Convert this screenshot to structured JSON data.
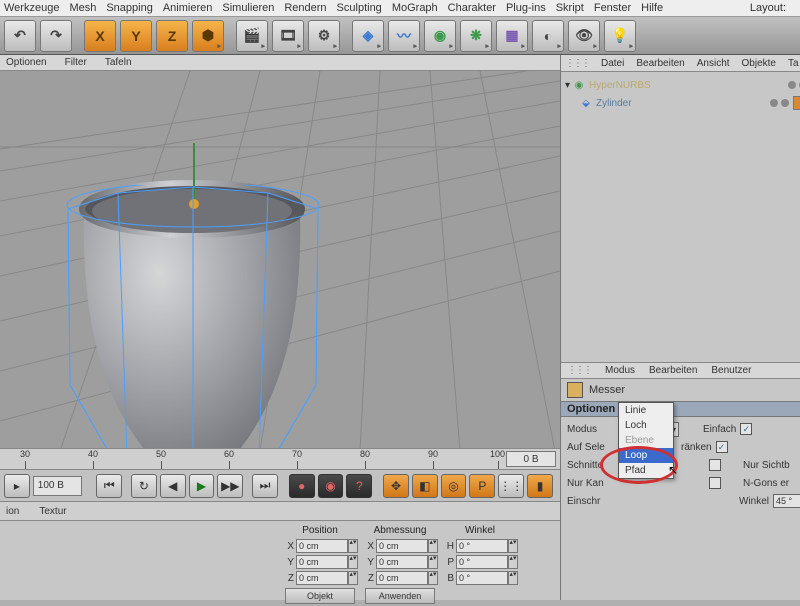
{
  "menu": [
    "Werkzeuge",
    "Mesh",
    "Snapping",
    "Animieren",
    "Simulieren",
    "Rendern",
    "Sculpting",
    "MoGraph",
    "Charakter",
    "Plug-ins",
    "Skript",
    "Fenster",
    "Hilfe"
  ],
  "layout_label": "Layout:",
  "toolbar": {
    "axes": [
      "X",
      "Y",
      "Z"
    ]
  },
  "viewbar": [
    "Optionen",
    "Filter",
    "Tafeln"
  ],
  "object_panel_menu": [
    "Datei",
    "Bearbeiten",
    "Ansicht",
    "Objekte",
    "Ta"
  ],
  "objects": [
    {
      "name": "HyperNURBS",
      "selected": true
    },
    {
      "name": "Zylinder",
      "selected": false,
      "indent": 1
    }
  ],
  "attr_menu": [
    "Modus",
    "Bearbeiten",
    "Benutzer"
  ],
  "tool_name": "Messer",
  "options_label": "Optionen",
  "options": {
    "modus_label": "Modus",
    "modus_value": "Linie",
    "einfach_label": "Einfach",
    "einfach_on": true,
    "auf_sel_label": "Auf Sele",
    "ranken_label": "ränken",
    "ranken_on": true,
    "schnitte_label": "Schnitte",
    "nur_kan_label": "Nur Kan",
    "nur_sicht_label": "Nur Sichtb",
    "ngons_label": "N-Gons er",
    "einschr_label": "Einschr",
    "winkel_label": "Winkel",
    "winkel_value": "45 °"
  },
  "dropdown_items": [
    "Linie",
    "Loch",
    "Ebene",
    "Loop",
    "Pfad"
  ],
  "dropdown_highlight": "Loop",
  "timeline": {
    "ticks": [
      30,
      40,
      50,
      60,
      70,
      80,
      90,
      100
    ],
    "end": "0 B"
  },
  "transport": {
    "frame": "100 B"
  },
  "bottom_tabs": [
    "ion",
    "Textur"
  ],
  "pospanel": {
    "headers": [
      "Position",
      "Abmessung",
      "Winkel"
    ],
    "rows": [
      {
        "axis": "X",
        "pos": "0 cm",
        "size": "0 cm",
        "ang_label": "H",
        "ang": "0 °"
      },
      {
        "axis": "Y",
        "pos": "0 cm",
        "size": "0 cm",
        "ang_label": "P",
        "ang": "0 °"
      },
      {
        "axis": "Z",
        "pos": "0 cm",
        "size": "0 cm",
        "ang_label": "B",
        "ang": "0 °"
      }
    ],
    "apply": [
      "Objekt",
      "Anwenden"
    ]
  }
}
